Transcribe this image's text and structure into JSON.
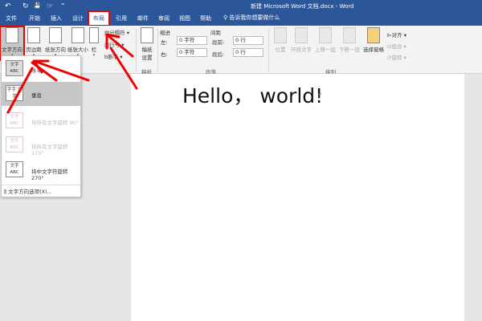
{
  "title": "新建 Microsoft Word 文档.docx - Word",
  "quick_access": {
    "undo": "↶",
    "redo": "↻",
    "save": "💾",
    "touch": "☞",
    "more": "⁼"
  },
  "tabs": [
    "文件",
    "开始",
    "插入",
    "设计",
    "布局",
    "引用",
    "邮件",
    "审阅",
    "视图",
    "帮助"
  ],
  "active_tab": "布局",
  "search": {
    "placeholder": "告诉我你想要做什么"
  },
  "ribbon": {
    "page_setup": {
      "text_direction": "文字方向",
      "margins": "页边距",
      "orientation": "纸张方向",
      "size": "纸张大小",
      "columns": "栏",
      "breaks": "分隔符",
      "line_numbers": "行号",
      "hyphenation": "断字"
    },
    "manuscript": {
      "button": "稿纸设置",
      "label": "稿纸"
    },
    "paragraph": {
      "indent": "缩进",
      "spacing": "间距",
      "left": "左:",
      "right": "右:",
      "before": "段前:",
      "after": "段后:",
      "left_value": "0 字符",
      "right_value": "0 字符",
      "before_value": "0 行",
      "after_value": "0 行",
      "label": "段落"
    },
    "arrange": {
      "position": "位置",
      "wrap": "环绕文字",
      "forward": "上移一层",
      "backward": "下移一层",
      "pane": "选择窗格",
      "align": "对齐",
      "group": "组合",
      "rotate": "旋转",
      "label": "排列"
    }
  },
  "menu": {
    "items": [
      {
        "label": "水平",
        "thumb": "文字 ABC",
        "state": "normal"
      },
      {
        "label": "垂直",
        "thumb": "字字 文文",
        "state": "selected"
      },
      {
        "label": "将所有文字旋转 90°",
        "thumb": "文字 ABC",
        "state": "disabled"
      },
      {
        "label": "将所有文字旋转 270°",
        "thumb": "文字 ABC",
        "state": "disabled"
      },
      {
        "label": "将中文字符旋转 270°",
        "thumb": "文字 ABC",
        "state": "normal"
      }
    ],
    "options": "文字方向选项(X)..."
  },
  "document": {
    "text": "Hello， world!",
    "mark": "↵"
  },
  "colors": {
    "brand": "#2b579a",
    "annotation": "#e00000"
  }
}
